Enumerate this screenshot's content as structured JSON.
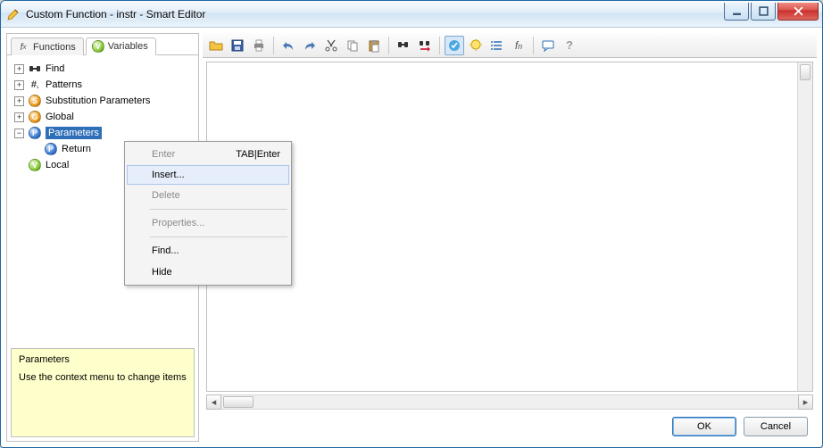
{
  "window": {
    "title": "Custom Function - instr - Smart Editor"
  },
  "tabs": {
    "functions": {
      "label": "Functions",
      "icon": "fx"
    },
    "variables": {
      "label": "Variables",
      "icon": "V"
    }
  },
  "tree": {
    "find": "Find",
    "patterns": "Patterns",
    "substitution": "Substitution Parameters",
    "global": "Global",
    "parameters": "Parameters",
    "return": "Return",
    "local": "Local"
  },
  "hint": {
    "title": "Parameters",
    "body": "Use the context menu to change items"
  },
  "context_menu": {
    "enter": {
      "label": "Enter",
      "shortcut": "TAB|Enter",
      "enabled": false
    },
    "insert": {
      "label": "Insert...",
      "enabled": true,
      "hover": true
    },
    "delete": {
      "label": "Delete",
      "enabled": false
    },
    "properties": {
      "label": "Properties...",
      "enabled": false
    },
    "find": {
      "label": "Find...",
      "enabled": true
    },
    "hide": {
      "label": "Hide",
      "enabled": true
    }
  },
  "toolbar": {
    "icons": [
      "open-icon",
      "save-icon",
      "print-icon",
      "sep",
      "undo-icon",
      "redo-icon",
      "cut-icon",
      "copy-icon",
      "paste-icon",
      "sep",
      "find-icon",
      "find-replace-icon",
      "sep",
      "validate-icon",
      "highlight-icon",
      "list-icon",
      "fx-icon",
      "sep",
      "comment-icon",
      "help-icon"
    ]
  },
  "buttons": {
    "ok": "OK",
    "cancel": "Cancel"
  },
  "colors": {
    "selection": "#2f6fb8",
    "hint_bg": "#ffffcc",
    "menu_hover": "#e6eefb"
  }
}
